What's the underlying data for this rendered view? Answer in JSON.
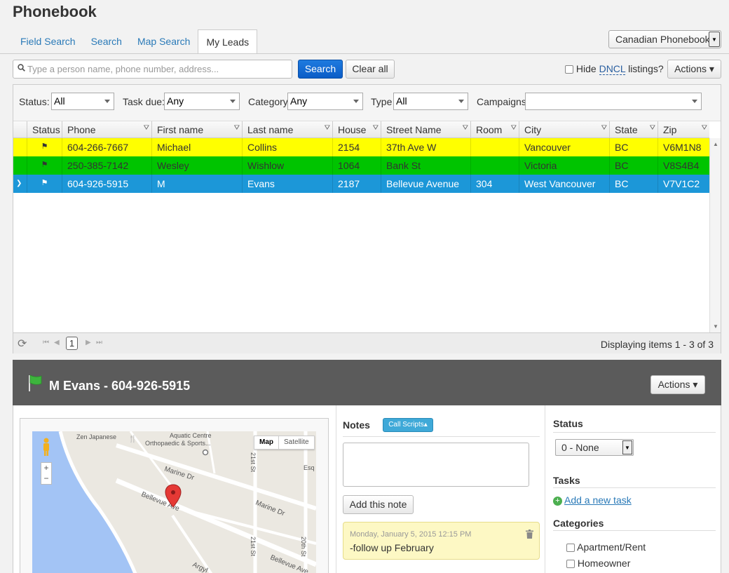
{
  "app": {
    "title": "Phonebook"
  },
  "tabs": [
    {
      "label": "Field Search"
    },
    {
      "label": "Search"
    },
    {
      "label": "Map Search"
    },
    {
      "label": "My Leads"
    }
  ],
  "region": {
    "selected": "Canadian Phonebook"
  },
  "search": {
    "placeholder": "Type a person name, phone number, address...",
    "button": "Search",
    "clear": "Clear all"
  },
  "toolbar": {
    "hide_prefix": "Hide",
    "hide_dncl": "DNCL",
    "hide_suffix": "listings?",
    "actions": "Actions ▾"
  },
  "filters": {
    "status_label": "Status:",
    "status_value": "All",
    "task_label": "Task due:",
    "task_value": "Any",
    "category_label": "Category",
    "category_value": "Any",
    "type_label": "Type",
    "type_value": "All",
    "campaigns_label": "Campaigns",
    "campaigns_value": ""
  },
  "grid": {
    "columns": [
      "Status",
      "Phone",
      "First name",
      "Last name",
      "House",
      "Street Name",
      "Room",
      "City",
      "State",
      "Zip"
    ],
    "rows": [
      {
        "phone": "604-266-7667",
        "first": "Michael",
        "last": "Collins",
        "house": "2154",
        "street": "37th Ave W",
        "room": "",
        "city": "Vancouver",
        "state": "BC",
        "zip": "V6M1N8"
      },
      {
        "phone": "250-385-7142",
        "first": "Wesley",
        "last": "Wishlow",
        "house": "1064",
        "street": "Bank St",
        "room": "",
        "city": "Victoria",
        "state": "BC",
        "zip": "V8S4B4"
      },
      {
        "phone": "604-926-5915",
        "first": "M",
        "last": "Evans",
        "house": "2187",
        "street": "Bellevue Avenue",
        "room": "304",
        "city": "West Vancouver",
        "state": "BC",
        "zip": "V7V1C2"
      }
    ],
    "row_colors": [
      "#ffff00",
      "#00c400",
      "#1c97d8"
    ]
  },
  "pager": {
    "page": "1",
    "info": "Displaying items 1 - 3 of 3"
  },
  "detail": {
    "title": "M Evans - 604-926-5915",
    "actions": "Actions ▾",
    "map": {
      "type_map": "Map",
      "type_satellite": "Satellite",
      "labels": [
        "Zen Japanese",
        "Aquatic Centre",
        "Orthopaedic & Sports...",
        "Marine Dr",
        "Bellevue Ave",
        "Marine Dr",
        "21st St",
        "21st St",
        "20th St",
        "Esq",
        "Argyl",
        "Bellevue Ave"
      ]
    },
    "notes": {
      "title": "Notes",
      "call_scripts": "Call Scripts▴",
      "add_button": "Add this note",
      "entries": [
        {
          "timestamp": "Monday, January 5, 2015 12:15 PM",
          "text": "-follow up February"
        }
      ]
    },
    "status": {
      "title": "Status",
      "selected": "0 - None"
    },
    "tasks": {
      "title": "Tasks",
      "add_link": "Add a new task"
    },
    "categories": {
      "title": "Categories",
      "items": [
        "Apartment/Rent",
        "Homeowner"
      ]
    }
  }
}
